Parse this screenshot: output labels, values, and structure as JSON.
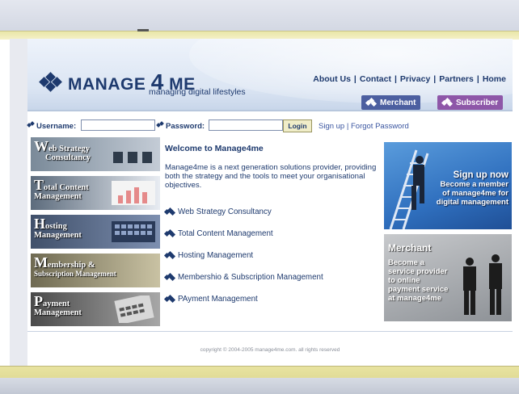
{
  "header": {
    "logo_pre": "MANAGE",
    "logo_num": "4",
    "logo_post": "ME",
    "tagline": "managing digital lifestyles",
    "nav": [
      "About Us",
      "Contact",
      "Privacy",
      "Partners",
      "Home"
    ],
    "merchant_button": "Merchant",
    "subscriber_button": "Subscriber"
  },
  "login": {
    "username_label": "Username:",
    "password_label": "Password:",
    "button": "Login",
    "signup": "Sign up",
    "separator": "|",
    "forgot": "Forgot Password"
  },
  "sidebar": [
    {
      "cap": "W",
      "rest": "eb Strategy",
      "line2": "Consultancy"
    },
    {
      "cap": "T",
      "rest": "otal Content",
      "line2": "Management"
    },
    {
      "cap": "H",
      "rest": "osting",
      "line2": "Management"
    },
    {
      "cap": "M",
      "rest": "embership &",
      "line2": "Subscription Management"
    },
    {
      "cap": "P",
      "rest": "ayment",
      "line2": "Management"
    }
  ],
  "main": {
    "title": "Welcome to Manage4me",
    "intro": "Manage4me is a next generation solutions provider, providing both the strategy and the tools to meet your organisational objectives.",
    "services": [
      "Web Strategy Consultancy",
      "Total Content Management",
      "Hosting Management",
      "Membershio & Subscription Management",
      "PAyment Management"
    ]
  },
  "promos": {
    "signup_line1": "Sign up now",
    "signup_line2": "Become a member of manage4me for digital management",
    "merchant_title": "Merchant",
    "merchant_text": "Become a service provider to online payment service at manage4me"
  },
  "footer": {
    "copyright": "copyright © 2004-2005 manage4me.com. all rights reserved"
  },
  "colors": {
    "brand": "#1e3a6e",
    "merchant_btn": "#4c5fa0",
    "subscriber_btn": "#8e57a8"
  }
}
